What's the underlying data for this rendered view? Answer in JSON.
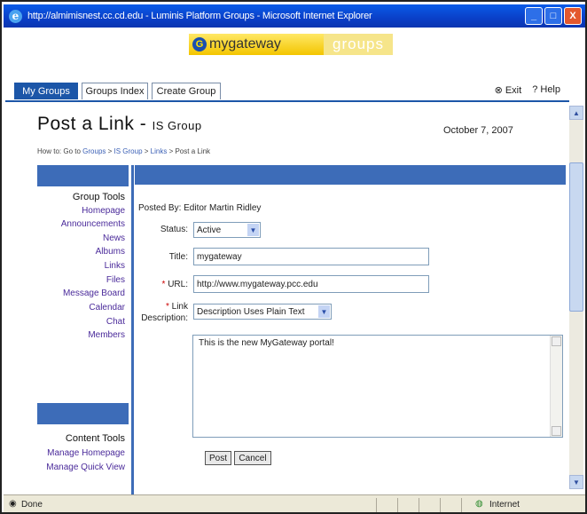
{
  "window": {
    "title": "http://almimisnest.cc.cd.edu - Luminis Platform Groups - Microsoft Internet Explorer",
    "icon": "ie-icon",
    "buttons": {
      "minimize": "_",
      "maximize": "□",
      "close": "X"
    }
  },
  "banner": {
    "logo_main": "mygateway",
    "logo_groups": "groups",
    "logo_mark": "G"
  },
  "tabs": [
    {
      "label": "My Groups",
      "active": true
    },
    {
      "label": "Groups Index",
      "active": false
    },
    {
      "label": "Create Group",
      "active": false
    }
  ],
  "toplinks": {
    "exit": "Exit",
    "help": "Help"
  },
  "page": {
    "title": "Post a Link",
    "separator": " - ",
    "group_name": "IS Group",
    "date": "October 7, 2007",
    "breadcrumb_prefix": "How to: Go to",
    "breadcrumb_links": [
      "Groups",
      "IS Group",
      "Links",
      "Post a Link"
    ]
  },
  "leftnav": {
    "group_tools_title": "Group Tools",
    "group_tools": [
      "Homepage",
      "Announcements",
      "News",
      "Albums",
      "Links",
      "Files",
      "Message Board",
      "Calendar",
      "Chat",
      "Members"
    ],
    "content_tools_title": "Content Tools",
    "content_tools": [
      "Manage Homepage",
      "Manage Quick View"
    ]
  },
  "form": {
    "posted_by_label": "Posted By:",
    "posted_by_value": "Editor Martin Ridley",
    "status_label": "Status:",
    "status_value": "Active",
    "title_label": "Title:",
    "title_value": "mygateway",
    "url_label": "URL:",
    "url_value": "http://www.mygateway.pcc.edu",
    "link_desc_label_1": "Link",
    "link_desc_label_2": "Description:",
    "desc_format_value": "Description Uses Plain Text",
    "description_text": "This is the new MyGateway portal!",
    "post_button": "Post",
    "cancel_button": "Cancel"
  },
  "statusbar": {
    "left_text": "Done",
    "zone_text": "Internet"
  },
  "colors": {
    "titlebar": "#0a4fd8",
    "nav_blue": "#3d6cb8",
    "tab_active": "#1c56a8",
    "logo_yellow": "#f3c500"
  }
}
